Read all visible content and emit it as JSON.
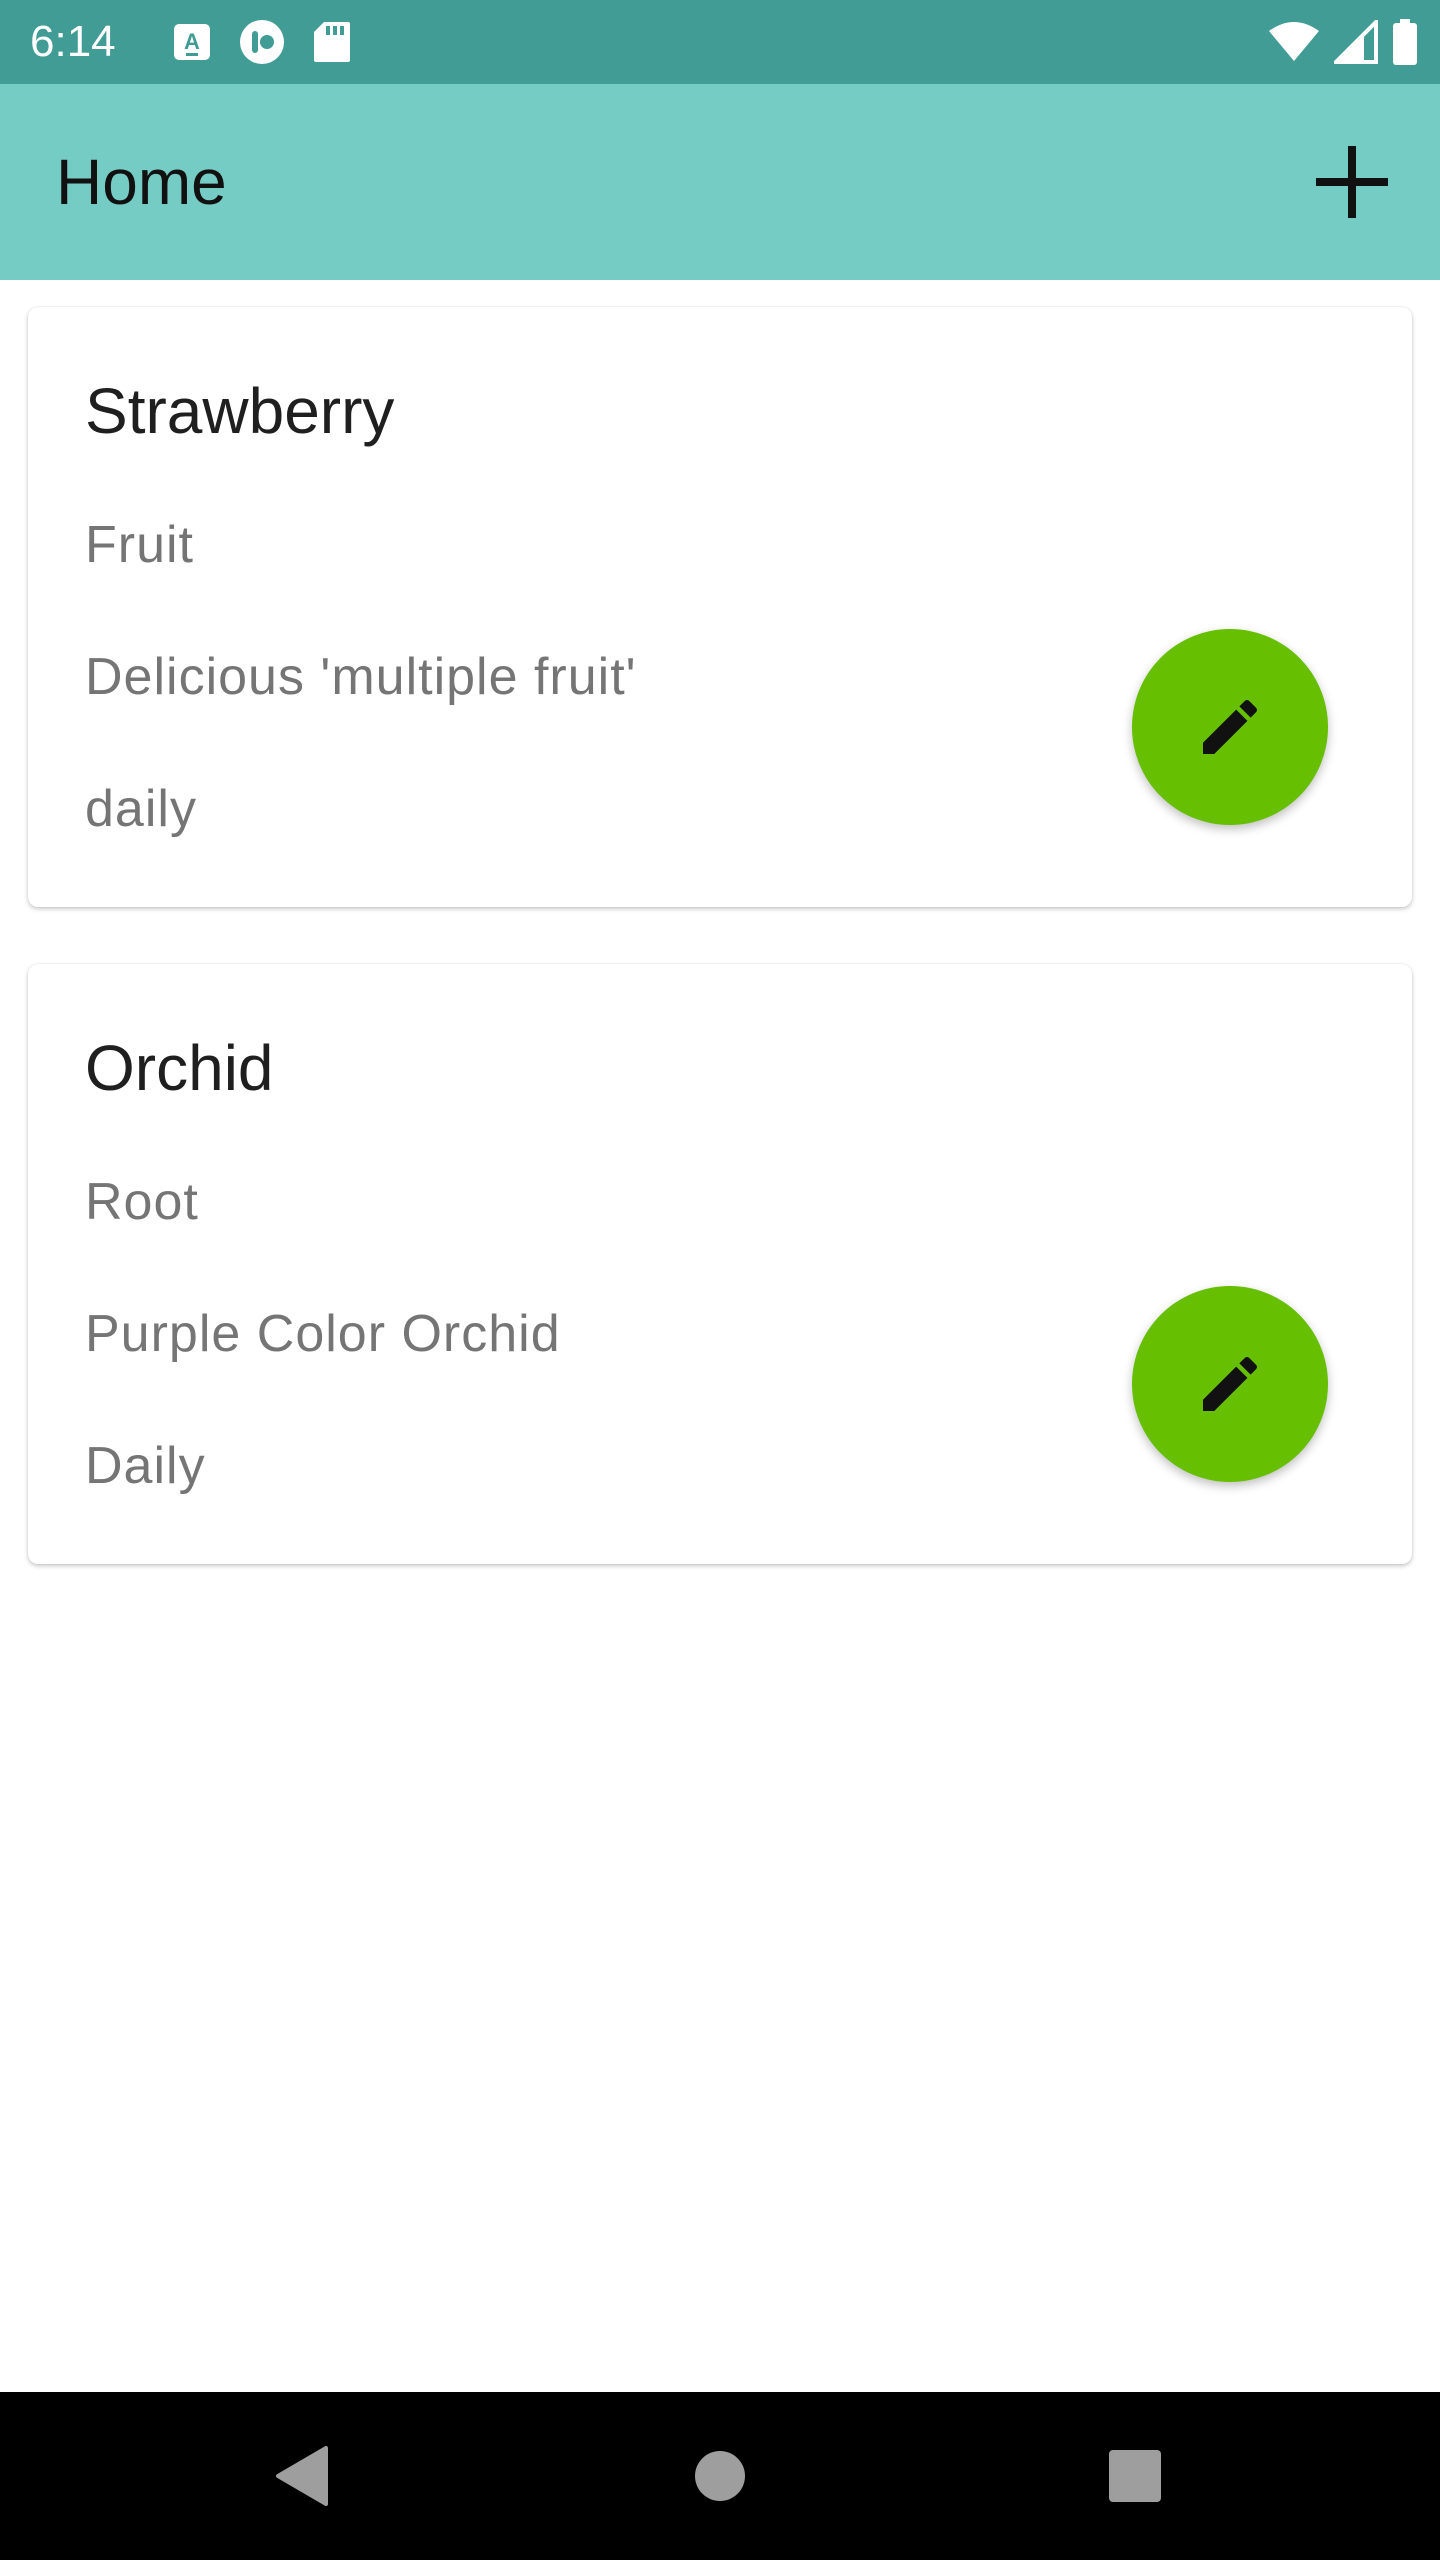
{
  "status_bar": {
    "time": "6:14",
    "left_icons": [
      "keyboard-a-icon",
      "app-notification-icon",
      "sd-card-icon"
    ],
    "right_icons": [
      "wifi-icon",
      "cell-signal-icon",
      "battery-icon"
    ]
  },
  "app_bar": {
    "title": "Home",
    "add_icon": "plus-icon"
  },
  "plants": [
    {
      "name": "Strawberry",
      "type": "Fruit",
      "description": "Delicious 'multiple fruit'",
      "frequency": "daily",
      "edit_icon": "pencil-icon"
    },
    {
      "name": "Orchid",
      "type": "Root",
      "description": "Purple Color Orchid",
      "frequency": "Daily",
      "edit_icon": "pencil-icon"
    }
  ],
  "nav_bar": {
    "buttons": [
      "back-icon",
      "home-icon",
      "recents-icon"
    ]
  },
  "colors": {
    "status_bar": "#419c95",
    "app_bar": "#74ccc4",
    "fab": "#66bf00",
    "card_text_secondary": "#757575"
  }
}
